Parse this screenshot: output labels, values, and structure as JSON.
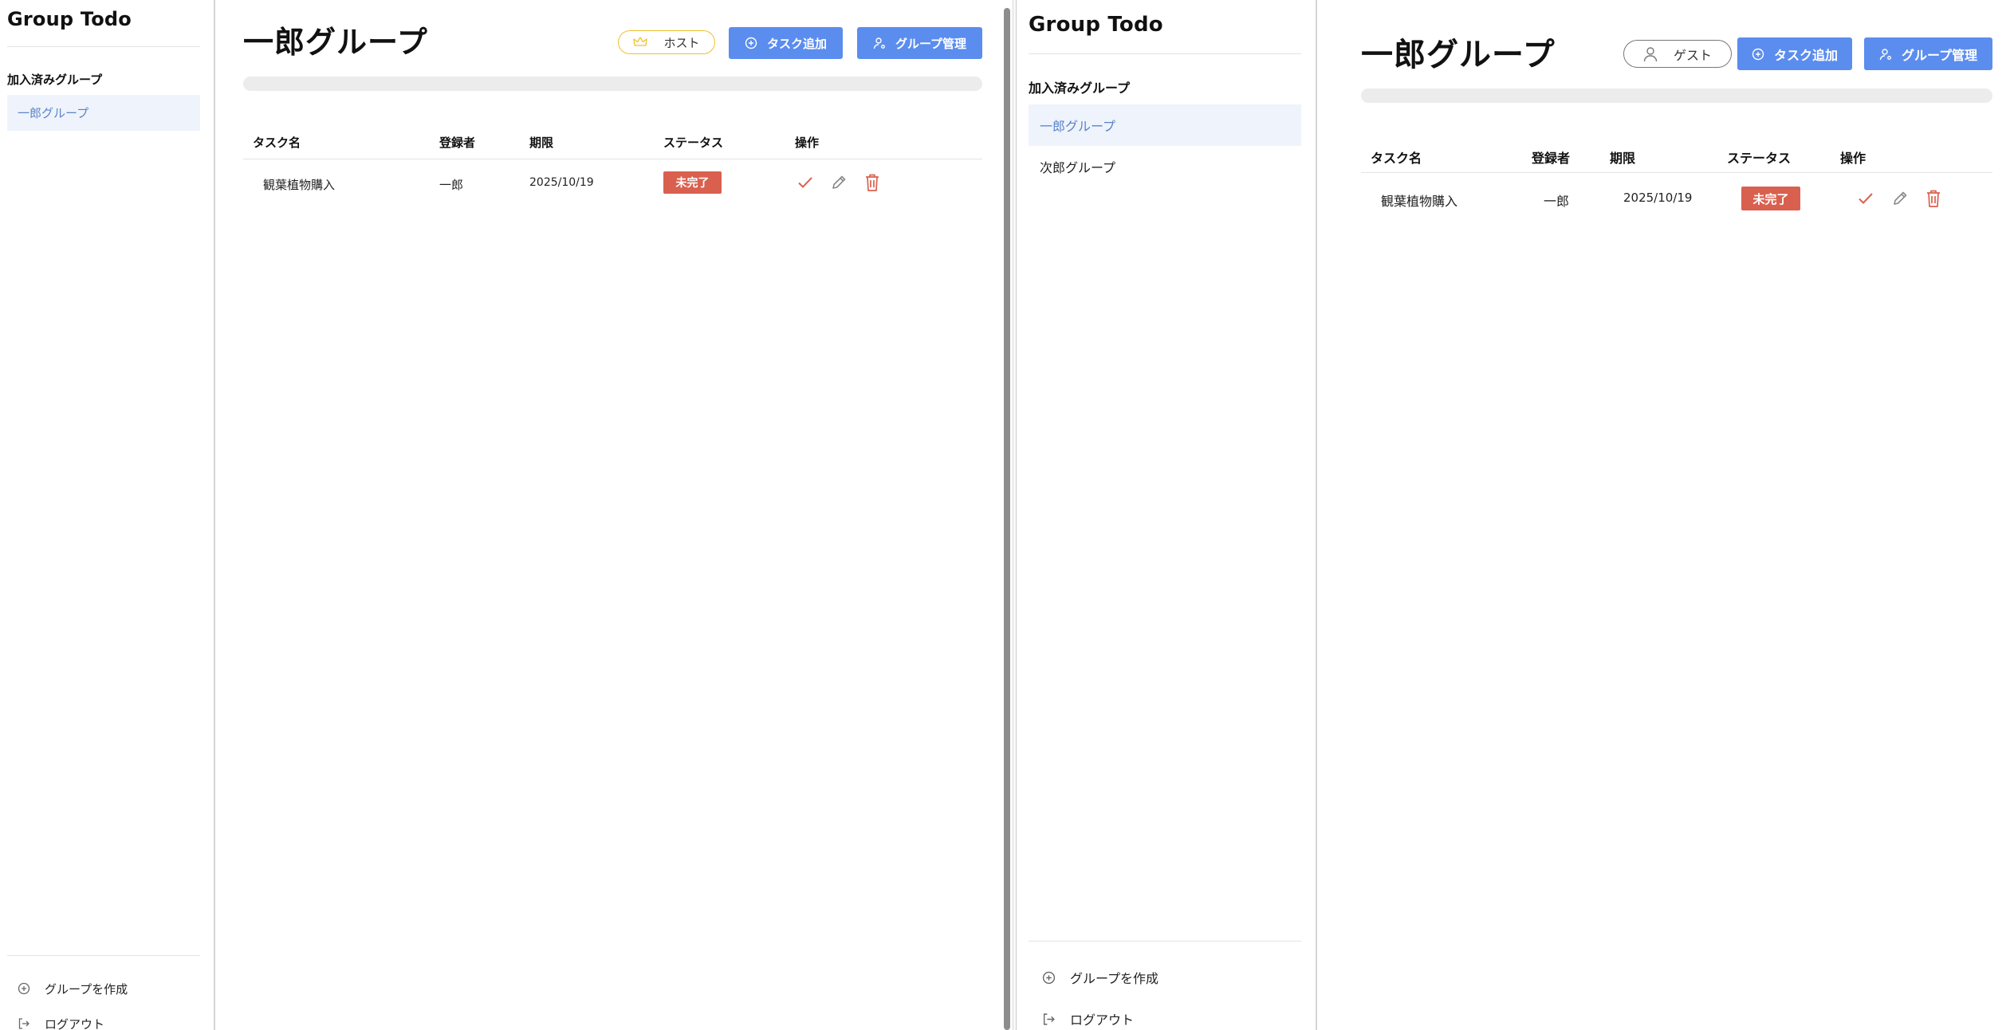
{
  "app_title": "Group Todo",
  "sidebar": {
    "section_label": "加入済みグループ",
    "create_group_label": "グループを作成",
    "logout_label": "ログアウト"
  },
  "left": {
    "groups": [
      "一郎グループ"
    ],
    "page_title": "一郎グループ",
    "role_label": "ホスト",
    "role_icon": "crown-icon",
    "role_color": "#f0c030"
  },
  "right": {
    "groups": [
      "一郎グループ",
      "次郎グループ"
    ],
    "page_title": "一郎グループ",
    "role_label": "ゲスト",
    "role_icon": "user-icon",
    "role_color": "#777777"
  },
  "toolbar": {
    "add_task_label": "タスク追加",
    "manage_group_label": "グループ管理"
  },
  "progress": {
    "value": 0
  },
  "table": {
    "headers": [
      "タスク名",
      "登録者",
      "期限",
      "ステータス",
      "操作"
    ],
    "rows": [
      {
        "task": "観葉植物購入",
        "owner": "一郎",
        "due": "2025/10/19",
        "status": "未完了"
      }
    ]
  },
  "colors": {
    "accent": "#5b8def",
    "status_incomplete": "#d9604f",
    "active_group_bg": "#eef3fc",
    "active_group_text": "#5b83c8"
  }
}
